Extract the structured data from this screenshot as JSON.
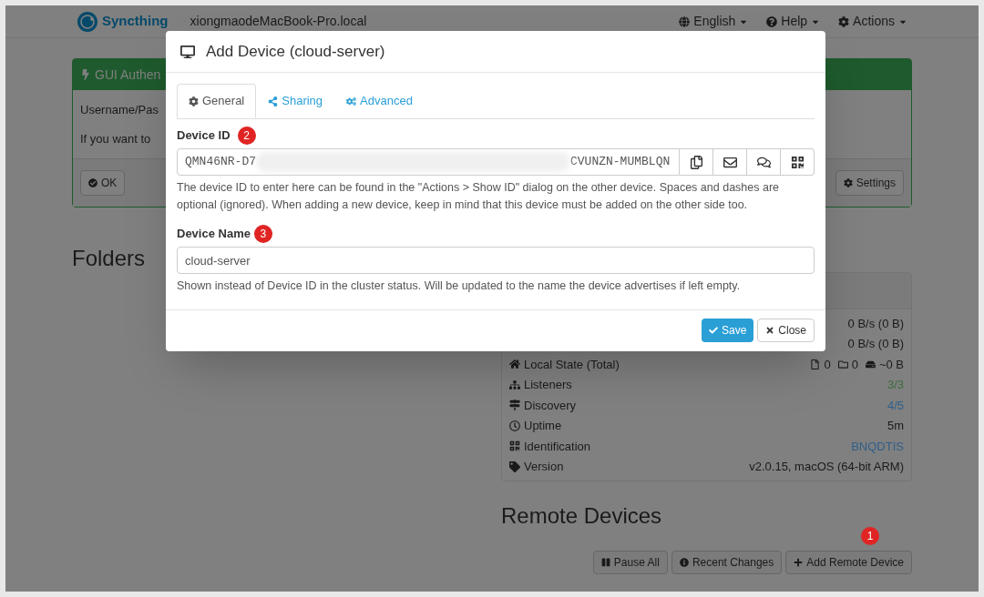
{
  "navbar": {
    "brand": "Syncthing",
    "host": "xiongmaodeMacBook-Pro.local",
    "menus": [
      {
        "kind": "language",
        "label": "English"
      },
      {
        "kind": "help",
        "label": "Help"
      },
      {
        "kind": "actions",
        "label": "Actions"
      }
    ]
  },
  "notice": {
    "title": "GUI Authen",
    "lines": [
      "Username/Pas",
      "If you want to"
    ],
    "buttons": [
      {
        "kind": "ok",
        "label": "OK"
      },
      {
        "kind": "settings",
        "label": "Settings"
      }
    ]
  },
  "folders": {
    "heading": "Folders"
  },
  "stats": [
    {
      "kind": "plain",
      "value": "0 B/s (0 B)"
    },
    {
      "kind": "plain",
      "value": "0 B/s (0 B)"
    },
    {
      "kind": "local",
      "label": "Local State (Total)",
      "files": "0",
      "dirs": "0",
      "size": "~0 B"
    },
    {
      "kind": "listeners",
      "label": "Listeners",
      "value": "3/3",
      "color": "#3d6b3d"
    },
    {
      "kind": "discovery",
      "label": "Discovery",
      "value": "4/5",
      "color": "#2f5f8a"
    },
    {
      "kind": "uptime",
      "label": "Uptime",
      "value": "5m",
      "color": "#1a1a1a"
    },
    {
      "kind": "identification",
      "label": "Identification",
      "value": "BNQDTIS",
      "color": "#2f5f8a"
    },
    {
      "kind": "version",
      "label": "Version",
      "value": "v2.0.15, macOS (64-bit ARM)",
      "color": "#1a1a1a"
    }
  ],
  "remote": {
    "heading": "Remote Devices",
    "buttons": [
      {
        "kind": "pause",
        "label": "Pause All"
      },
      {
        "kind": "info",
        "label": "Recent Changes"
      },
      {
        "kind": "add",
        "label": "Add Remote Device",
        "badge": "1"
      }
    ]
  },
  "modal": {
    "title": "Add Device (cloud-server)",
    "tabs": [
      {
        "kind": "general",
        "label": "General",
        "selected": true
      },
      {
        "kind": "sharing",
        "label": "Sharing",
        "selected": false
      },
      {
        "kind": "advanced",
        "label": "Advanced",
        "selected": false
      }
    ],
    "device_id": {
      "label": "Device ID",
      "badge": "2",
      "value_start": "QMN46NR-D7",
      "value_end": "CVUNZN-MUMBLQN",
      "help": "The device ID to enter here can be found in the \"Actions > Show ID\" dialog on the other device. Spaces and dashes are optional (ignored). When adding a new device, keep in mind that this device must be added on the other side too."
    },
    "device_name": {
      "label": "Device Name",
      "badge": "3",
      "value": "cloud-server",
      "help": "Shown instead of Device ID in the cluster status. Will be updated to the name the device advertises if left empty."
    },
    "buttons": [
      {
        "kind": "save",
        "label": "Save"
      },
      {
        "kind": "close",
        "label": "Close"
      }
    ]
  }
}
